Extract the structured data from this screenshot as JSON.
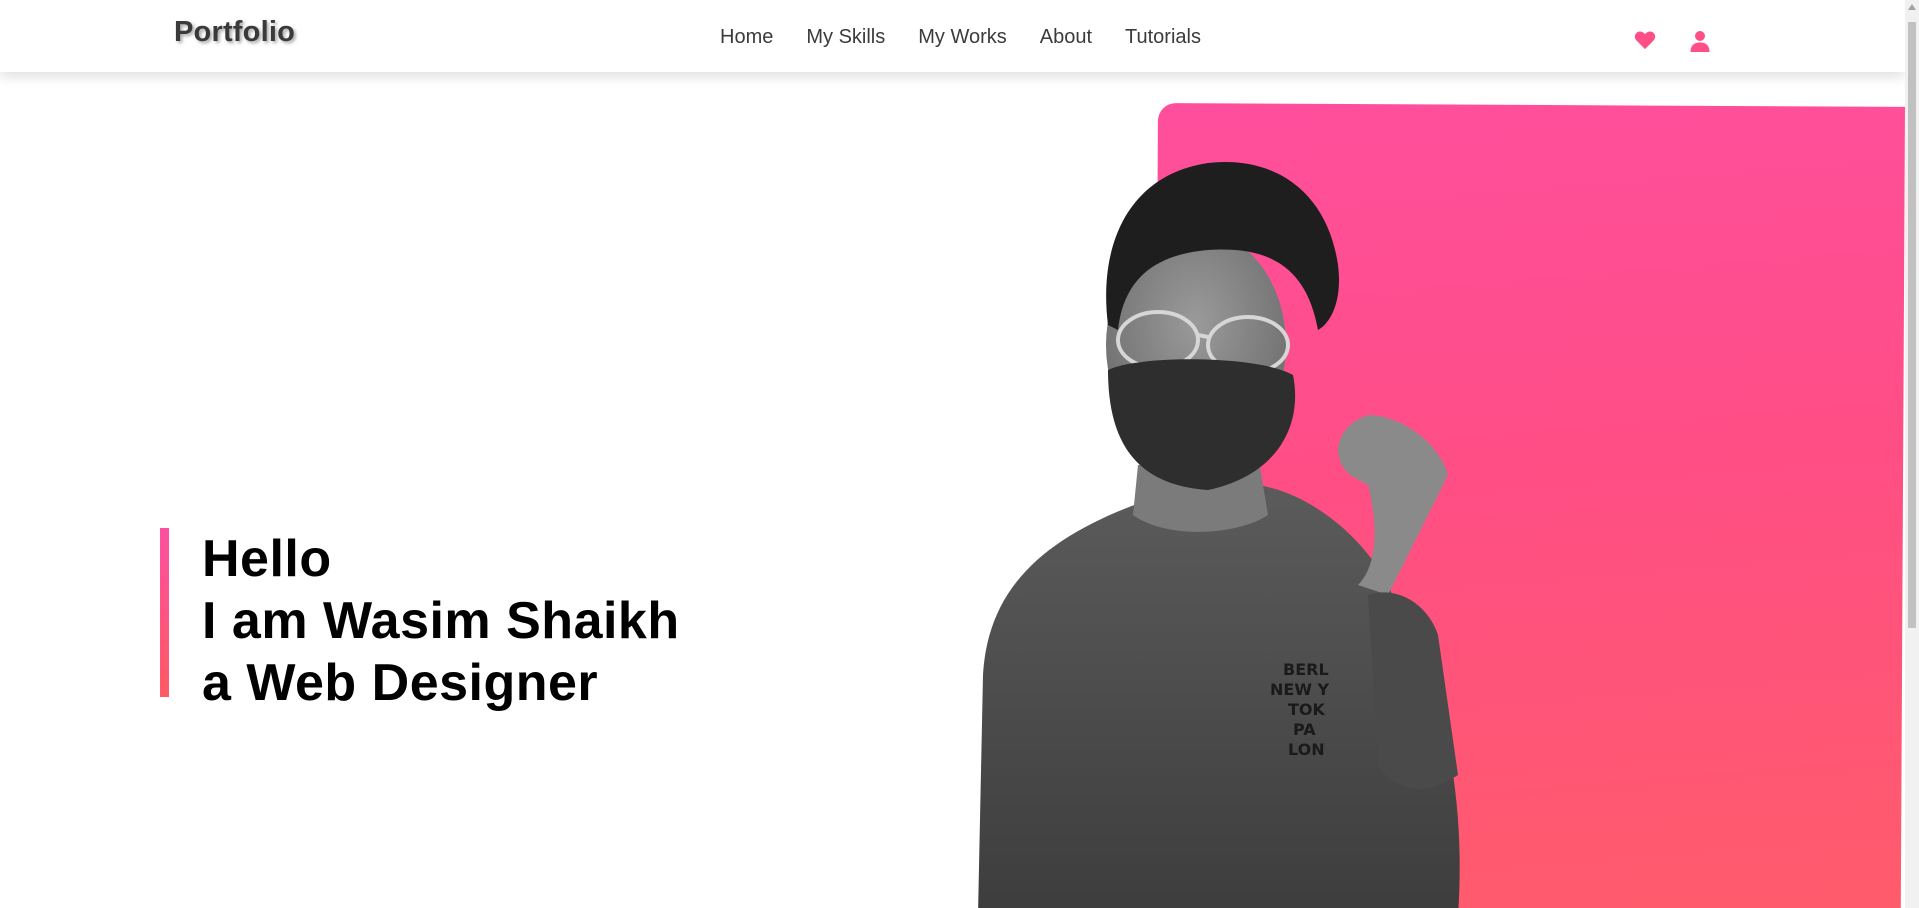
{
  "brand": {
    "logo_text": "Portfolio",
    "accent_color": "#ff4f8f"
  },
  "nav": {
    "items": [
      {
        "label": "Home"
      },
      {
        "label": "My Skills"
      },
      {
        "label": "My Works"
      },
      {
        "label": "About"
      },
      {
        "label": "Tutorials"
      }
    ],
    "icons": [
      {
        "name": "heart-icon",
        "color": "#ff4f86"
      },
      {
        "name": "user-icon",
        "color": "#ff4f86"
      }
    ]
  },
  "hero": {
    "line1": "Hello",
    "line2": "I am Wasim Shaikh",
    "line3": "a Web Designer",
    "panel_gradient": [
      "#ff4f9d",
      "#ff5c6a"
    ],
    "photo_description_icon": "person-photo"
  }
}
